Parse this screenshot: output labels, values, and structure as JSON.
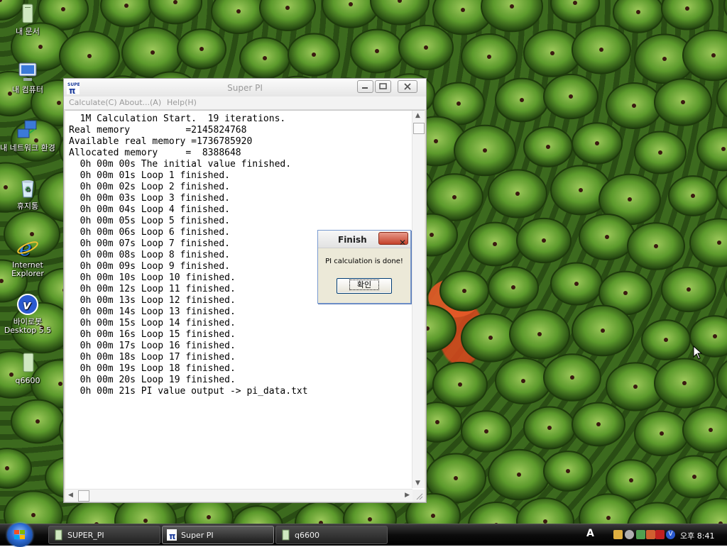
{
  "desktop": {
    "icons": [
      {
        "label": "내 문서"
      },
      {
        "label": "내 컴퓨터"
      },
      {
        "label": "내 네트워크 환경"
      },
      {
        "label": "휴지통"
      },
      {
        "label": "Internet Explorer"
      },
      {
        "label": "바이로봇 Desktop 5.5"
      },
      {
        "label": "q6600"
      }
    ]
  },
  "superpi": {
    "title": "Super PI",
    "app_icon_text": "SUPER π",
    "menu": {
      "calculate": "Calculate(C)",
      "about": "About...(A)",
      "help": "Help(H)"
    },
    "output_lines": [
      "  1M Calculation Start.  19 iterations.",
      "Real memory          =2145824768",
      "Available real memory =1736785920",
      "Allocated memory     =  8388648",
      "  0h 00m 00s The initial value finished.",
      "  0h 00m 01s Loop 1 finished.",
      "  0h 00m 02s Loop 2 finished.",
      "  0h 00m 03s Loop 3 finished.",
      "  0h 00m 04s Loop 4 finished.",
      "  0h 00m 05s Loop 5 finished.",
      "  0h 00m 06s Loop 6 finished.",
      "  0h 00m 07s Loop 7 finished.",
      "  0h 00m 08s Loop 8 finished.",
      "  0h 00m 09s Loop 9 finished.",
      "  0h 00m 10s Loop 10 finished.",
      "  0h 00m 12s Loop 11 finished.",
      "  0h 00m 13s Loop 12 finished.",
      "  0h 00m 14s Loop 13 finished.",
      "  0h 00m 15s Loop 14 finished.",
      "  0h 00m 16s Loop 15 finished.",
      "  0h 00m 17s Loop 16 finished.",
      "  0h 00m 18s Loop 17 finished.",
      "  0h 00m 19s Loop 18 finished.",
      "  0h 00m 20s Loop 19 finished.",
      "  0h 00m 21s PI value output -> pi_data.txt"
    ]
  },
  "dialog": {
    "title": "Finish",
    "close_label": "✕",
    "message": "PI calculation is done!",
    "ok_label": "확인"
  },
  "taskbar": {
    "tasks": [
      {
        "label": "SUPER_PI"
      },
      {
        "label": "Super PI"
      },
      {
        "label": "q6600"
      }
    ],
    "tray": {
      "lang_label": "A",
      "clock": "오후 8:41"
    }
  },
  "colors": {
    "taskbar": "#0c0c0c",
    "dialog_border": "#7a9bd0",
    "wallpaper_green": "#3c6a1e"
  }
}
